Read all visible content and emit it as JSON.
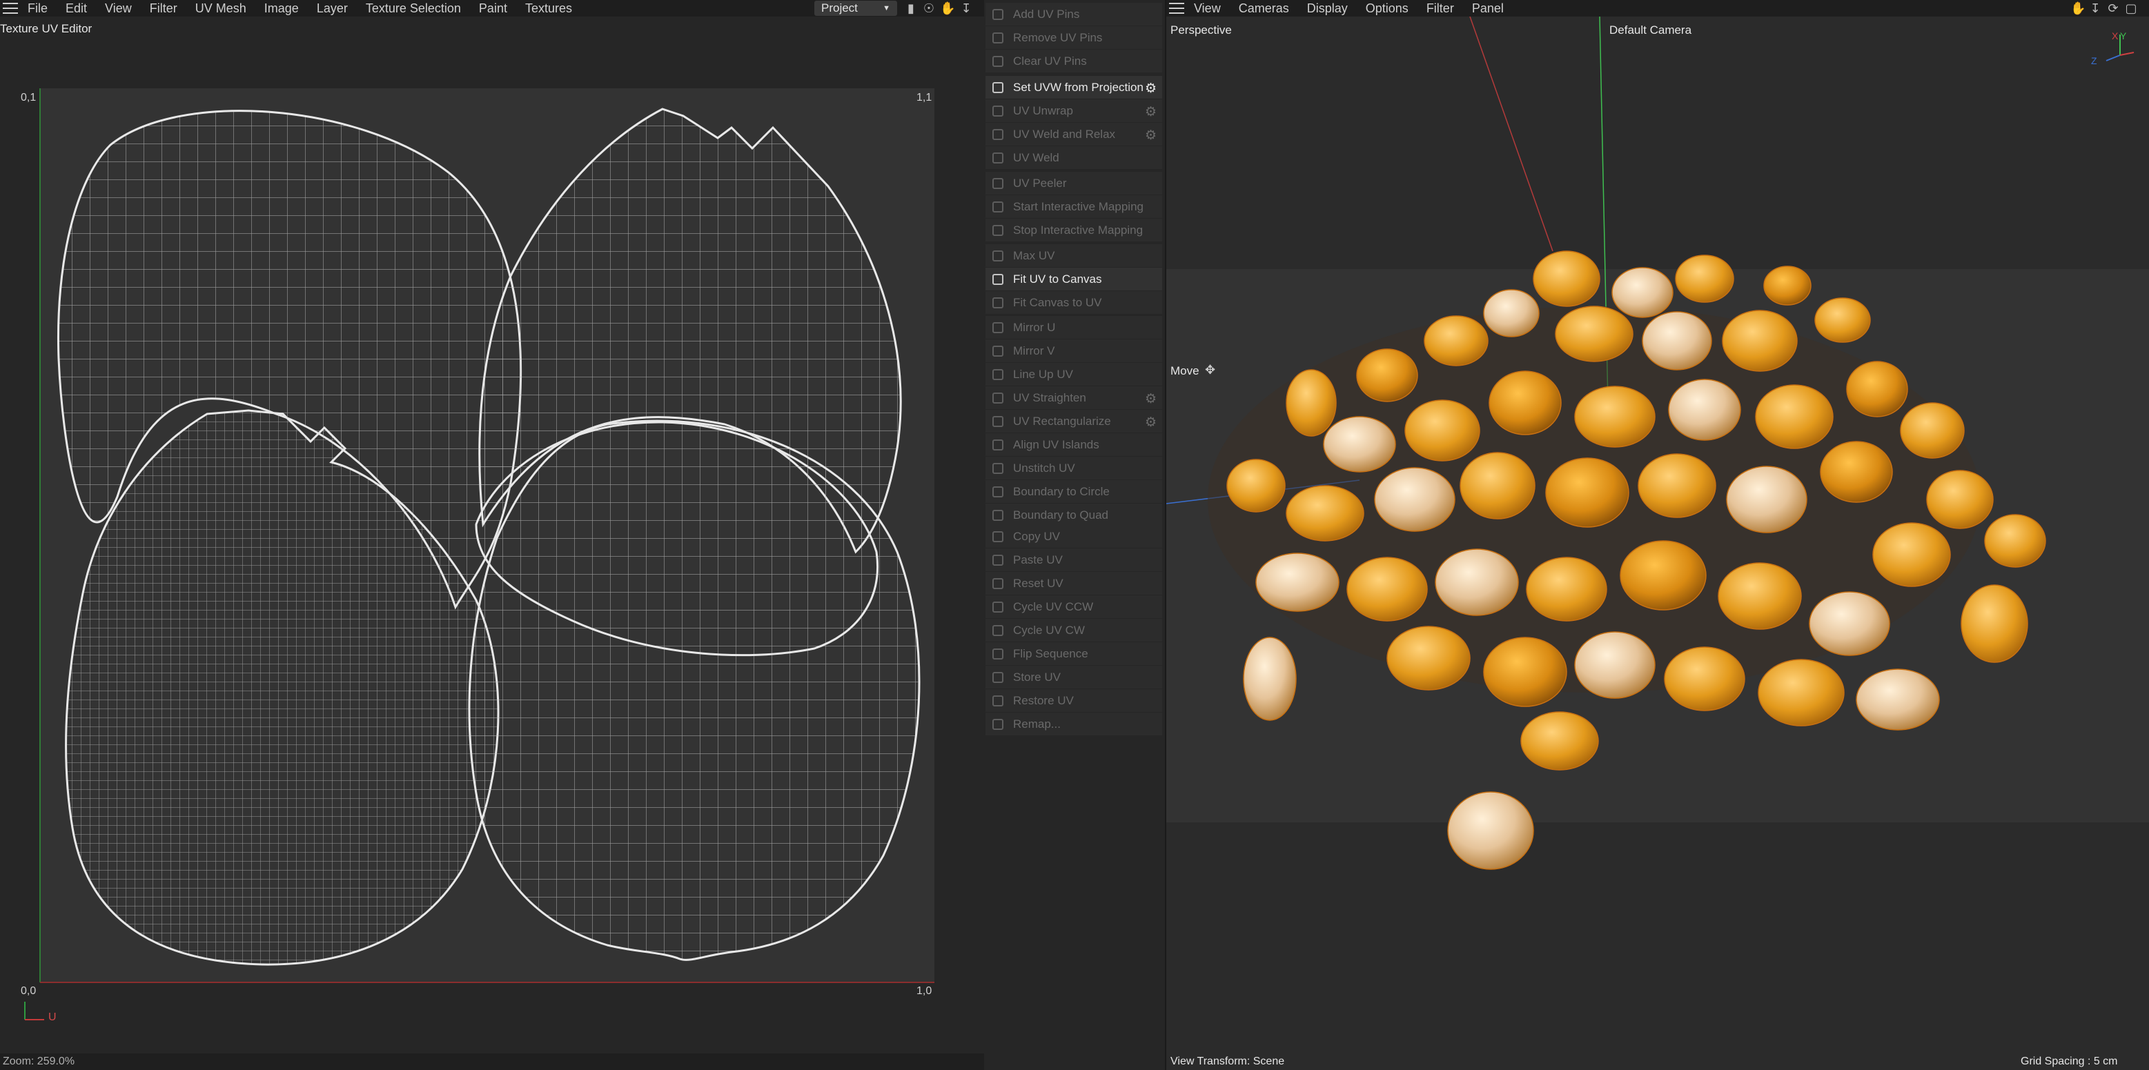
{
  "uv_editor": {
    "menu": [
      "File",
      "Edit",
      "View",
      "Filter",
      "UV Mesh",
      "Image",
      "Layer",
      "Texture Selection",
      "Paint",
      "Textures"
    ],
    "title": "Texture UV Editor",
    "project_select": "Project",
    "corners": {
      "top_left": "0,1",
      "top_right": "1,1",
      "bottom_left": "0,0",
      "bottom_right": "1,0"
    },
    "axis_label": "U",
    "zoom": "Zoom: 259.0%",
    "accent_colors": {
      "canvas": "#333333",
      "v_axis": "#2f7a36",
      "u_axis": "#8a2d2d",
      "wire": "#cfcfcf"
    }
  },
  "commands": {
    "groups": [
      [
        {
          "label": "Add UV Pins",
          "active": false
        },
        {
          "label": "Remove UV Pins",
          "active": false
        },
        {
          "label": "Clear UV Pins",
          "active": false
        }
      ],
      [
        {
          "label": "Set UVW from Projection",
          "active": true,
          "gear": true
        },
        {
          "label": "UV Unwrap",
          "active": false,
          "gear": true
        },
        {
          "label": "UV Weld and Relax",
          "active": false,
          "gear": true
        },
        {
          "label": "UV Weld",
          "active": false
        }
      ],
      [
        {
          "label": "UV Peeler",
          "active": false
        },
        {
          "label": "Start Interactive Mapping",
          "active": false
        },
        {
          "label": "Stop Interactive Mapping",
          "active": false
        }
      ],
      [
        {
          "label": "Max UV",
          "active": false
        },
        {
          "label": "Fit UV to Canvas",
          "active": true
        },
        {
          "label": "Fit Canvas to UV",
          "active": false
        }
      ],
      [
        {
          "label": "Mirror U",
          "active": false
        },
        {
          "label": "Mirror V",
          "active": false
        },
        {
          "label": "Line Up UV",
          "active": false
        },
        {
          "label": "UV Straighten",
          "active": false,
          "gear": true
        },
        {
          "label": "UV Rectangularize",
          "active": false,
          "gear": true
        },
        {
          "label": "Align UV Islands",
          "active": false
        },
        {
          "label": "Unstitch UV",
          "active": false
        },
        {
          "label": "Boundary to Circle",
          "active": false
        },
        {
          "label": "Boundary to Quad",
          "active": false
        }
      ],
      [
        {
          "label": "Copy UV",
          "active": false
        },
        {
          "label": "Paste UV",
          "active": false
        },
        {
          "label": "Reset UV",
          "active": false
        },
        {
          "label": "Cycle UV CCW",
          "active": false
        },
        {
          "label": "Cycle UV CW",
          "active": false
        },
        {
          "label": "Flip Sequence",
          "active": false
        },
        {
          "label": "Store UV",
          "active": false
        },
        {
          "label": "Restore UV",
          "active": false
        },
        {
          "label": "Remap...",
          "active": false
        }
      ]
    ]
  },
  "viewport": {
    "menu": [
      "View",
      "Cameras",
      "Display",
      "Options",
      "Filter",
      "Panel"
    ],
    "view_name": "Perspective",
    "camera": "Default Camera",
    "tool": "Move",
    "view_transform": "View Transform: Scene",
    "grid_spacing": "Grid Spacing : 5 cm",
    "axis_gizmo": {
      "x": "X",
      "y": "Y",
      "z": "Z"
    },
    "kernel_colors": [
      "#e39a1c",
      "#f0b03a",
      "#d98a12",
      "#e8c59a",
      "#c9841a",
      "#f5c76a"
    ]
  }
}
